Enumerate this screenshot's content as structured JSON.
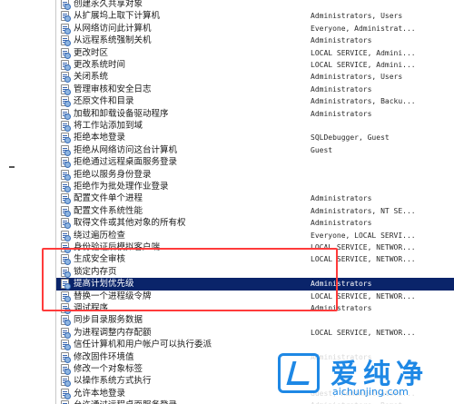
{
  "rows": [
    {
      "policy": "创建永久共享对象",
      "setting": ""
    },
    {
      "policy": "从扩展坞上取下计算机",
      "setting": "Administrators, Users"
    },
    {
      "policy": "从网络访问此计算机",
      "setting": "Everyone, Administrat..."
    },
    {
      "policy": "从远程系统强制关机",
      "setting": "Administrators"
    },
    {
      "policy": "更改时区",
      "setting": "LOCAL SERVICE, Admini..."
    },
    {
      "policy": "更改系统时间",
      "setting": "LOCAL SERVICE, Admini..."
    },
    {
      "policy": "关闭系统",
      "setting": "Administrators, Users"
    },
    {
      "policy": "管理审核和安全日志",
      "setting": "Administrators"
    },
    {
      "policy": "还原文件和目录",
      "setting": "Administrators, Backu..."
    },
    {
      "policy": "加载和卸载设备驱动程序",
      "setting": "Administrators"
    },
    {
      "policy": "将工作站添加到域",
      "setting": ""
    },
    {
      "policy": "拒绝本地登录",
      "setting": "SQLDebugger, Guest"
    },
    {
      "policy": "拒绝从网络访问这台计算机",
      "setting": "Guest"
    },
    {
      "policy": "拒绝通过远程桌面服务登录",
      "setting": ""
    },
    {
      "policy": "拒绝以服务身份登录",
      "setting": ""
    },
    {
      "policy": "拒绝作为批处理作业登录",
      "setting": ""
    },
    {
      "policy": "配置文件单个进程",
      "setting": "Administrators"
    },
    {
      "policy": "配置文件系统性能",
      "setting": "Administrators, NT SE..."
    },
    {
      "policy": "取得文件或其他对象的所有权",
      "setting": "Administrators"
    },
    {
      "policy": "绕过遍历检查",
      "setting": "Everyone, LOCAL SERVI..."
    },
    {
      "policy": "身份验证后模拟客户端",
      "setting": "LOCAL SERVICE, NETWOR..."
    },
    {
      "policy": "生成安全审核",
      "setting": "LOCAL SERVICE, NETWOR..."
    },
    {
      "policy": "锁定内存页",
      "setting": ""
    },
    {
      "policy": "提高计划优先级",
      "setting": "Administrators",
      "selected": true
    },
    {
      "policy": "替换一个进程级令牌",
      "setting": "LOCAL SERVICE, NETWOR..."
    },
    {
      "policy": "调试程序",
      "setting": "Administrators"
    },
    {
      "policy": "同步目录服务数据",
      "setting": ""
    },
    {
      "policy": "为进程调整内存配额",
      "setting": "LOCAL SERVICE, NETWOR..."
    },
    {
      "policy": "信任计算机和用户帐户可以执行委派",
      "setting": ""
    },
    {
      "policy": "修改固件环境值",
      "setting": "Administrators"
    },
    {
      "policy": "修改一个对象标签",
      "setting": ""
    },
    {
      "policy": "以操作系统方式执行",
      "setting": ""
    },
    {
      "policy": "允许本地登录",
      "setting": "Guest, Administrators..."
    },
    {
      "policy": "允许通过远程桌面服务登录",
      "setting": "Administrators, Remot..."
    }
  ],
  "watermark": {
    "name": "爱纯净",
    "url": "aichunjing.com"
  }
}
